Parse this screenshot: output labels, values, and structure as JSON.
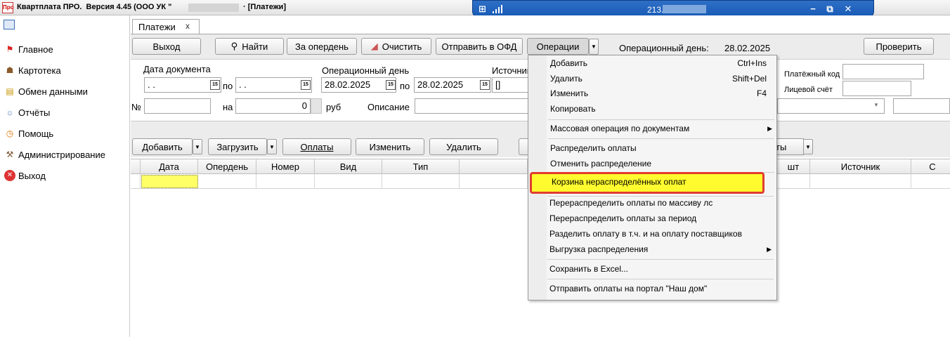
{
  "window": {
    "title_left": "Квартплата ПРО.  Версия 4.45 (ООО УК \"",
    "title_right": "· [Платежи]",
    "app_icon": "Про"
  },
  "remote_bar": {
    "host": "213.",
    "pin_icon": "pin-icon",
    "controls": [
      "minimize-icon",
      "restore-icon",
      "close-icon"
    ]
  },
  "nav": {
    "items": [
      {
        "label": "Главное",
        "icon": "flag-icon"
      },
      {
        "label": "Картотека",
        "icon": "people-icon"
      },
      {
        "label": "Обмен данными",
        "icon": "exchange-icon"
      },
      {
        "label": "Отчёты",
        "icon": "reports-icon"
      },
      {
        "label": "Помощь",
        "icon": "help-icon"
      },
      {
        "label": "Администрирование",
        "icon": "admin-icon"
      },
      {
        "label": "Выход",
        "icon": "exit-icon"
      }
    ]
  },
  "tab": {
    "label": "Платежи",
    "close": "x"
  },
  "toolbar": {
    "exit": "Выход",
    "find": "Найти",
    "day": "За опердень",
    "clear": "Очистить",
    "ofd": "Отправить в ОФД",
    "operations": "Операции",
    "op_day_label": "Операционный день:",
    "op_day_value": "28.02.2025",
    "check": "Проверить"
  },
  "filters": {
    "doc_date_label": "Дата документа",
    "doc_date_from": " .  .",
    "po1": "по",
    "doc_date_to": " .  .",
    "op_day_label": "Операционный день",
    "op_from": "28.02.2025",
    "po2": "по",
    "op_to": "28.02.2025",
    "source_label": "Источник",
    "source_value": "[]",
    "num_label": "№",
    "na_label": "на",
    "amount": "0",
    "rub": "руб",
    "desc_label": "Описание",
    "pay_code_label": "Платёжный код",
    "account_label": "Лицевой счёт",
    "cal_icon": "15"
  },
  "grid_toolbar": {
    "add": "Добавить",
    "load": "Загрузить",
    "payments": "Оплаты",
    "edit": "Изменить",
    "delete": "Удалить",
    "payments2": "ты"
  },
  "grid": {
    "columns": [
      "Дата",
      "Опердень",
      "Номер",
      "Вид",
      "Тип",
      "шт",
      "Источник",
      "С"
    ]
  },
  "menu": {
    "items": [
      {
        "label": "Добавить",
        "shortcut": "Ctrl+Ins"
      },
      {
        "label": "Удалить",
        "shortcut": "Shift+Del"
      },
      {
        "label": "Изменить",
        "shortcut": "F4"
      },
      {
        "label": "Копировать",
        "shortcut": ""
      },
      {
        "label": "Массовая операция по документам",
        "submenu": "▶"
      },
      {
        "label": "Распределить оплаты"
      },
      {
        "label": "Отменить распределение"
      },
      {
        "label": "Корзина нераспределённых оплат"
      },
      {
        "label": "Перераспределить оплаты по массиву лс"
      },
      {
        "label": "Перераспределить оплаты за период"
      },
      {
        "label": "Разделить оплату в т.ч. и на оплату поставщиков"
      },
      {
        "label": "Выгрузка распределения",
        "submenu": "▶"
      },
      {
        "label": "Сохранить в Excel..."
      },
      {
        "label": "Отправить оплаты на портал \"Наш дом\""
      }
    ],
    "highlight_color": "#fffb2e",
    "highlight_border": "#e03d2f"
  }
}
